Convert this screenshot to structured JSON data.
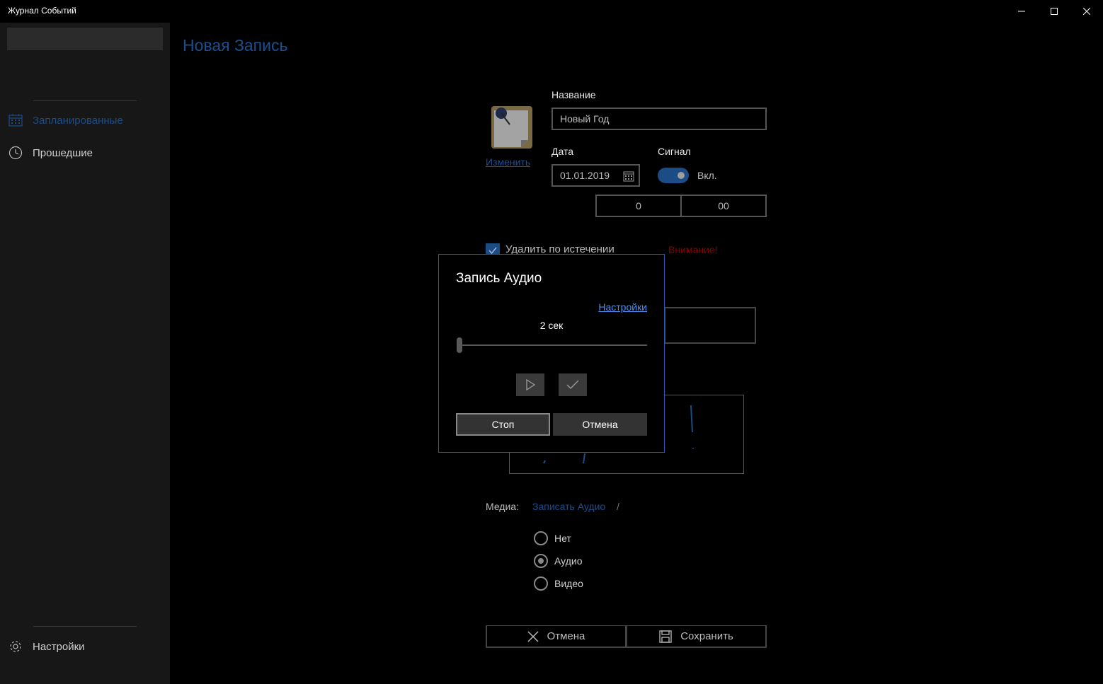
{
  "window": {
    "title": "Журнал Событий",
    "minimize_glyph": "—",
    "maximize_glyph": "☐",
    "close_glyph": "✕"
  },
  "sidebar": {
    "items": [
      {
        "label": "Запланированные",
        "icon": "calendar-icon",
        "selected": true
      },
      {
        "label": "Прошедшие",
        "icon": "clock-icon",
        "selected": false
      }
    ],
    "settings_label": "Настройки",
    "settings_icon": "gear-icon"
  },
  "page": {
    "title": "Новая Запись",
    "change_icon_link": "Изменить",
    "name_label": "Название",
    "name_value": "Новый Год",
    "date_label": "Дата",
    "date_value": "01.01.2019",
    "signal_label": "Сигнал",
    "signal_state": "Вкл.",
    "hour_value": "0",
    "minute_value": "00",
    "delete_on_expiry_label": "Удалить по истечении",
    "warning_text": "Внимание!",
    "media_label": "Медиа:",
    "record_audio_link": "Записать Аудио",
    "media_separator": "/",
    "media_options": [
      "Нет",
      "Аудио",
      "Видео"
    ],
    "media_selected": "Аудио",
    "cancel_label": "Отмена",
    "save_label": "Сохранить"
  },
  "dialog": {
    "title": "Запись Аудио",
    "settings_link": "Настройки",
    "elapsed": "2 сек",
    "progress": 0,
    "stop_label": "Стоп",
    "cancel_label": "Отмена"
  },
  "colors": {
    "accent": "#1c4c86",
    "dialog_border": "#2a5bb5",
    "link": "#4a8ff0",
    "warning": "#8b0000"
  }
}
